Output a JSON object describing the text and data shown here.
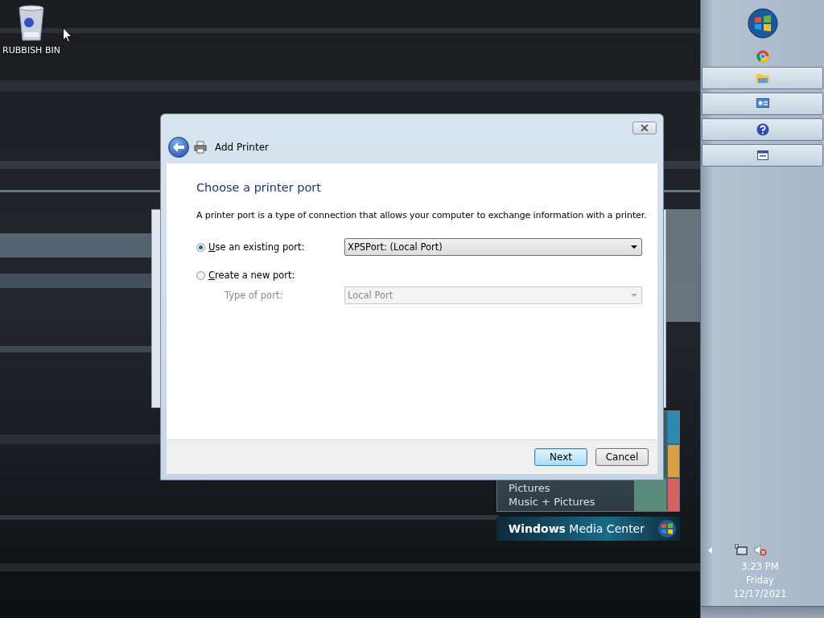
{
  "desktop_icons": [
    {
      "label": "RUBBISH BIN"
    }
  ],
  "media_center": {
    "items": [
      "Pictures",
      "Music + Pictures"
    ],
    "title": "**Windows** Media Center"
  },
  "dialog": {
    "title": "Add Printer",
    "heading": "Choose a printer port",
    "description": "A printer port is a type of connection that allows your computer to exchange information with a printer.",
    "port_options": [
      {
        "label": "Use an existing port:",
        "selected": true
      },
      {
        "label": "Create a new port:",
        "selected": false
      }
    ],
    "existing_port": {
      "value": "XPSPort: (Local Port)",
      "disabled": false
    },
    "new_port": {
      "label": "Type of port:",
      "value": "Local Port",
      "disabled": true
    },
    "buttons": [
      {
        "label": "Next",
        "default": true
      },
      {
        "label": "Cancel",
        "default": false
      }
    ]
  },
  "taskbar": {
    "clock": {
      "time": "3:23 PM",
      "day": "Friday",
      "date": "12/17/2021"
    }
  }
}
